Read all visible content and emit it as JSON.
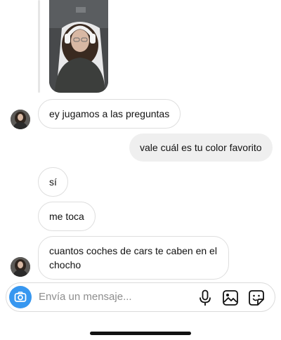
{
  "messages": [
    {
      "id": "m1",
      "side": "in",
      "text": "ey jugamos a las preguntas"
    },
    {
      "id": "m2",
      "side": "out",
      "text": "vale cuál es tu color favorito"
    },
    {
      "id": "m3",
      "side": "in",
      "text": "sí"
    },
    {
      "id": "m4",
      "side": "in",
      "text": "me toca"
    },
    {
      "id": "m5",
      "side": "in",
      "text": "cuantos coches de cars te caben en el chocho"
    }
  ],
  "composer": {
    "placeholder": "Envía un mensaje...",
    "icons": [
      "camera-icon",
      "microphone-icon",
      "gallery-icon",
      "sticker-icon"
    ]
  },
  "colors": {
    "accent": "#3797f0",
    "outgoing_bubble": "#efefef",
    "incoming_border": "#dedede"
  }
}
